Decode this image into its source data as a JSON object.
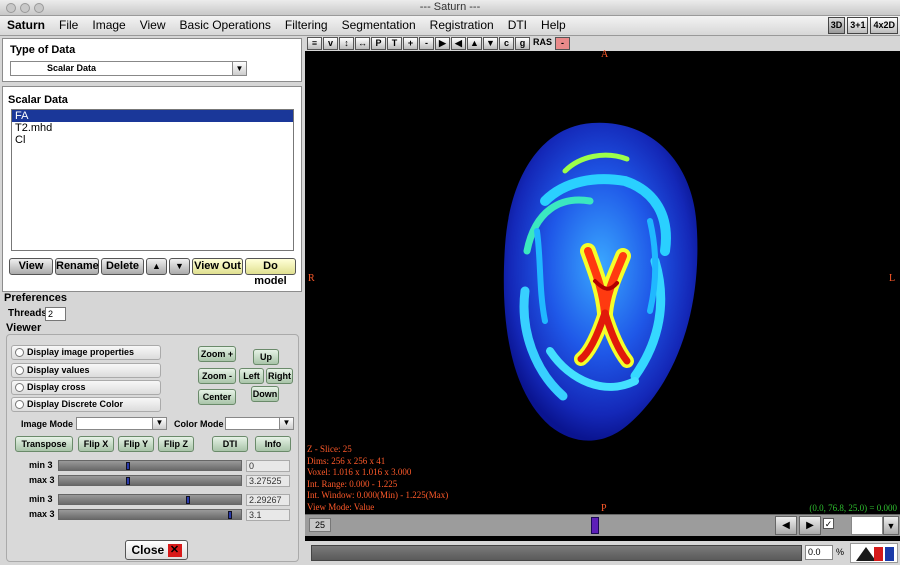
{
  "window": {
    "title": "--- Saturn ---"
  },
  "menu": [
    "Saturn",
    "File",
    "Image",
    "View",
    "Basic Operations",
    "Filtering",
    "Segmentation",
    "Registration",
    "DTI",
    "Help"
  ],
  "layout_buttons": [
    "3D",
    "3+1",
    "4x2D"
  ],
  "type_of_data": {
    "title": "Type of Data",
    "selected": "Scalar Data"
  },
  "scalar_data": {
    "title": "Scalar Data",
    "items": [
      "FA",
      "T2.mhd",
      "Cl"
    ],
    "selected_index": 0,
    "buttons": {
      "view": "View",
      "rename": "Rename",
      "delete": "Delete",
      "view_out": "View Out",
      "do_model": "Do model"
    }
  },
  "preferences": {
    "title": "Preferences",
    "threads_label": "Threads",
    "threads_value": "2"
  },
  "viewer_panel": {
    "title": "Viewer",
    "checks": [
      "Display image properties",
      "Display values",
      "Display cross",
      "Display Discrete Color"
    ],
    "nav": {
      "zoom_in": "Zoom +",
      "zoom_out": "Zoom -",
      "center": "Center",
      "up": "Up",
      "left": "Left",
      "right": "Right",
      "down": "Down"
    },
    "image_mode_label": "Image Mode",
    "color_mode_label": "Color Mode",
    "ops": [
      "Transpose",
      "Flip X",
      "Flip Y",
      "Flip Z",
      "DTI",
      "Info"
    ],
    "sliders": [
      {
        "label": "min 3",
        "value": "0",
        "fraction": 0.38
      },
      {
        "label": "max 3",
        "value": "3.27525",
        "fraction": 0.38
      },
      {
        "label": "min 3",
        "value": "2.29267",
        "fraction": 0.72
      },
      {
        "label": "max 3",
        "value": "3.1",
        "fraction": 0.96
      }
    ]
  },
  "close_label": "Close",
  "view_toolbar": [
    "≡",
    "v",
    "↕",
    "↔",
    "P",
    "T",
    "+",
    "-",
    "▶",
    "◀",
    "▲",
    "▼",
    "c",
    "g",
    "RAS",
    "-"
  ],
  "orientation": {
    "top": "A",
    "bottom": "P",
    "left": "R",
    "right": "L"
  },
  "info_lines": [
    "Z - Slice:  25",
    "Dims: 256 x 256 x  41",
    "Voxel: 1.016 x 1.016 x 3.000",
    "Int. Range: 0.000 - 1.225",
    "Int. Window: 0.000(Min) - 1.225(Max)",
    "View Mode: Value"
  ],
  "coord_readout": "(0.0,  76.8,  25.0) = 0.000",
  "slice_number": "25",
  "slice_fraction": 0.6,
  "opacity_value": "0.0",
  "opacity_unit": "%",
  "colors": {
    "selection": "#1a3799",
    "overlay_text": "#ff5a2a",
    "readout": "#2fbf2f"
  }
}
